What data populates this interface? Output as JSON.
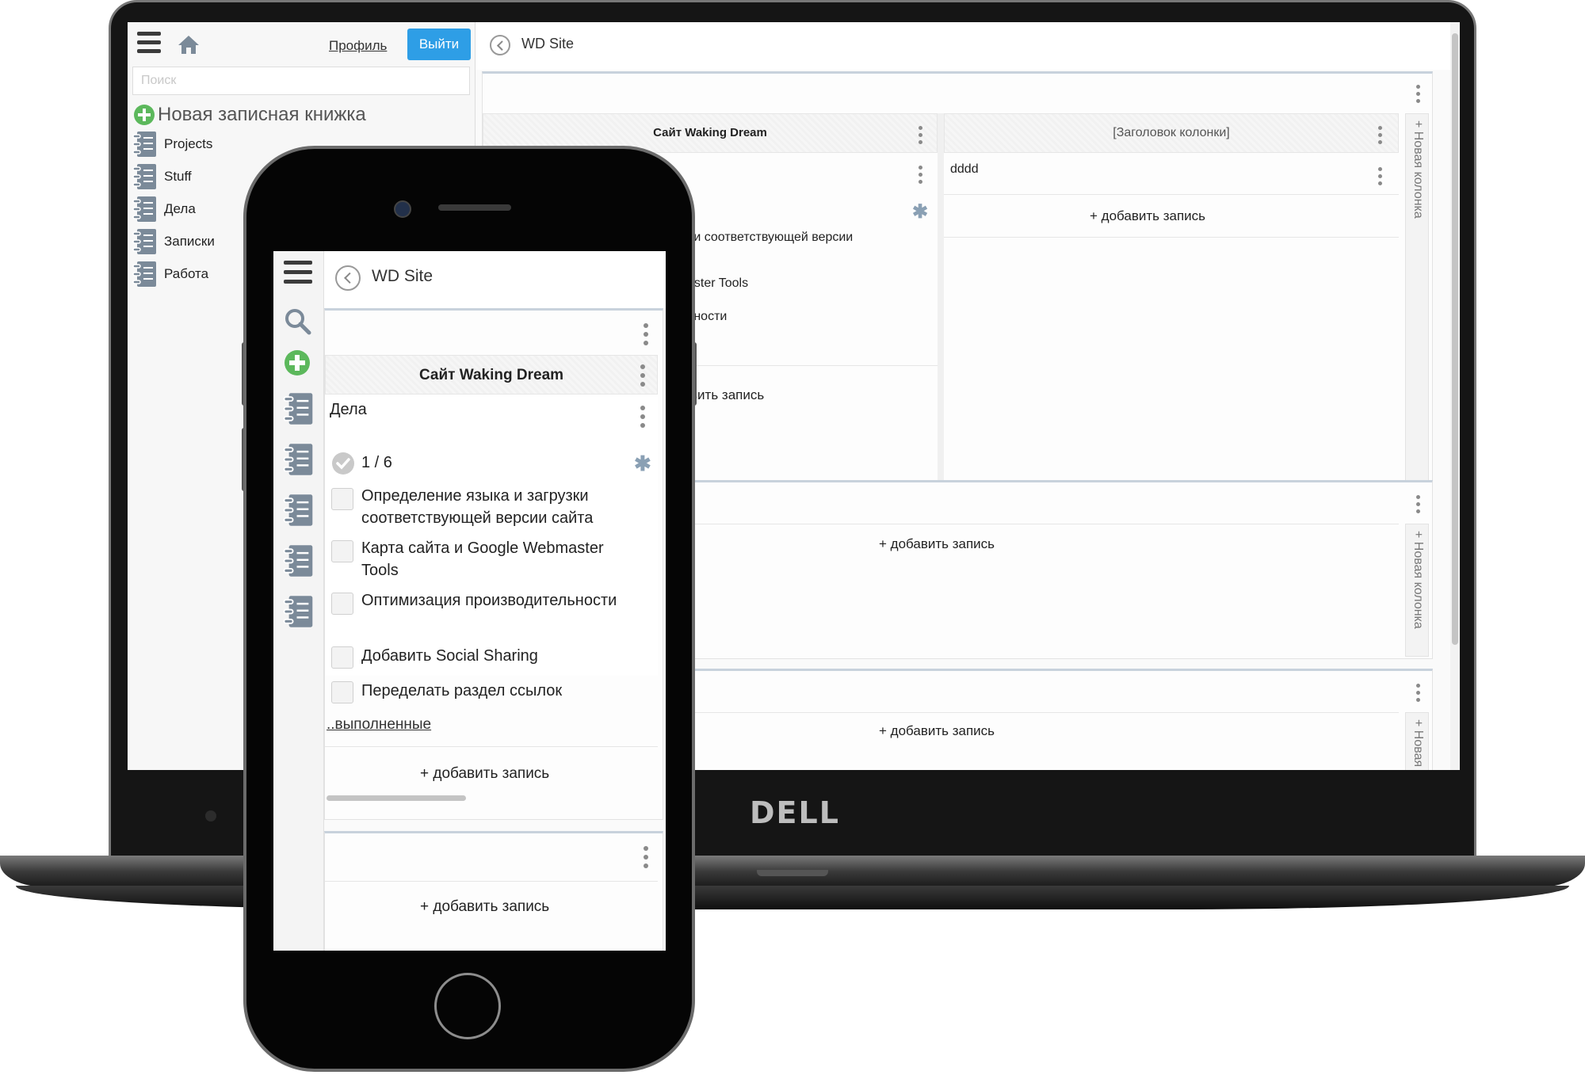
{
  "desktop": {
    "sidebar": {
      "profile_link": "Профиль",
      "logout_button": "Выйти",
      "search_placeholder": "Поиск",
      "new_notebook": "Новая записная книжка",
      "notebooks": [
        "Projects",
        "Stuff",
        "Дела",
        "Записки",
        "Работа"
      ]
    },
    "main": {
      "title": "WD Site",
      "column1_title": "Сайт Waking Dream",
      "column2_title": "[Заголовок колонки]",
      "column2_entry": "dddd",
      "partial_task_1": "зки соответствующей версии",
      "partial_task_2": "aster Tools",
      "partial_task_3": "ьности",
      "partial_add": "вить запись",
      "add_record": "+ добавить запись",
      "new_column": "+ Новая колонка",
      "new_column_cut": "+ Новая"
    }
  },
  "mobile": {
    "title": "WD Site",
    "column_title": "Сайт Waking Dream",
    "card_title": "Дела",
    "progress": "1 / 6",
    "tasks": [
      "Определение языка и загрузки соответствующей версии сайта",
      "Карта сайта и Google Webmaster Tools",
      "Оптимизация производительности",
      "Добавить Social Sharing",
      "Переделать раздел ссылок"
    ],
    "completed_link": "..выполненные",
    "add_record": "+ добавить запись"
  },
  "brand": {
    "laptop_logo": "DELL"
  },
  "colors": {
    "accent": "#2e9ee6",
    "add_green": "#5cb85c",
    "icon_gray": "#7b8a99"
  }
}
